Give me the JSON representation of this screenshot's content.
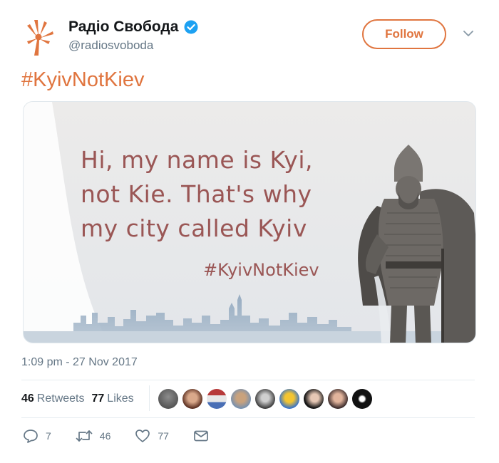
{
  "account": {
    "display_name": "Радіо Свобода",
    "handle": "@radiosvoboda",
    "verified": true,
    "logo_color": "#e0753f"
  },
  "header": {
    "follow_label": "Follow"
  },
  "tweet": {
    "text": "#KyivNotKiev",
    "media": {
      "lines": [
        "Hi, my name is Kyi,",
        "not Kie. That's why",
        "my city called Kyiv"
      ],
      "hashtag": "#KyivNotKiev"
    },
    "timestamp": "1:09 pm - 27 Nov 2017"
  },
  "stats": {
    "retweets_count": "46",
    "retweets_label": "Retweets",
    "likes_count": "77",
    "likes_label": "Likes",
    "avatar_count": 9
  },
  "actions": {
    "reply_count": "7",
    "retweet_count": "46",
    "like_count": "77"
  },
  "colors": {
    "accent": "#e0753f",
    "verified": "#1da1f2",
    "muted": "#657786",
    "image_text": "#9a5655"
  }
}
